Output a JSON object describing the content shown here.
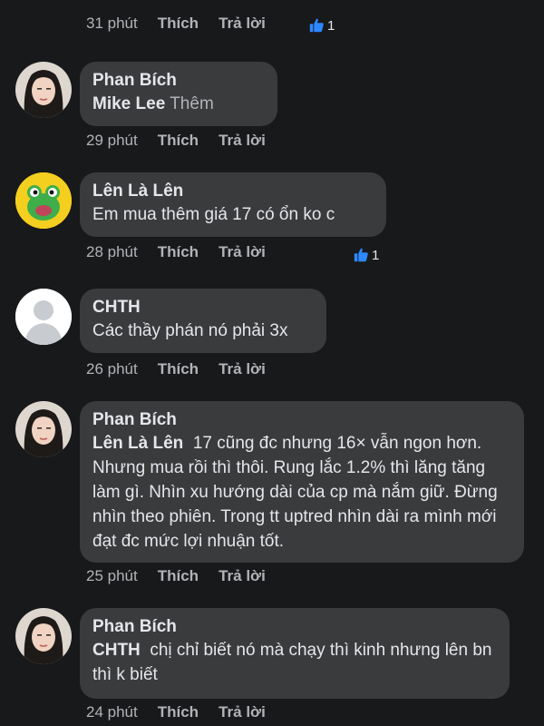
{
  "actions": {
    "like": "Thích",
    "reply": "Trả lời"
  },
  "comments": [
    {
      "time": "31 phút",
      "reactions": "1"
    },
    {
      "name": "Phan Bích",
      "tag": "Mike Lee",
      "more": "Thêm",
      "text": "",
      "time": "29 phút"
    },
    {
      "name": "Lên Là Lên",
      "text": "Em mua thêm giá 17 có ổn ko c",
      "time": "28 phút",
      "reactions": "1"
    },
    {
      "name": "CHTH",
      "text": "Các thầy phán nó phải 3x",
      "time": "26 phút"
    },
    {
      "name": "Phan Bích",
      "tag": "Lên Là Lên",
      "text": "17 cũng đc nhưng 16× vẫn ngon hơn. Nhưng mua rồi thì thôi. Rung lắc 1.2% thì lăng tăng làm gì. Nhìn xu hướng dài của cp mà nắm giữ. Đừng nhìn theo phiên. Trong tt uptred nhìn dài ra mình mới đạt đc mức lợi nhuận tốt.",
      "time": "25 phút"
    },
    {
      "name": "Phan Bích",
      "tag": "CHTH",
      "text": "chị chỉ biết nó mà chạy thì kinh nhưng lên bn thì k biết",
      "time": "24 phút"
    }
  ],
  "colors": {
    "background": "#18191a",
    "bubble": "#3a3b3c",
    "like_blue": "#2d88ff",
    "muted": "#b0b3b8"
  }
}
